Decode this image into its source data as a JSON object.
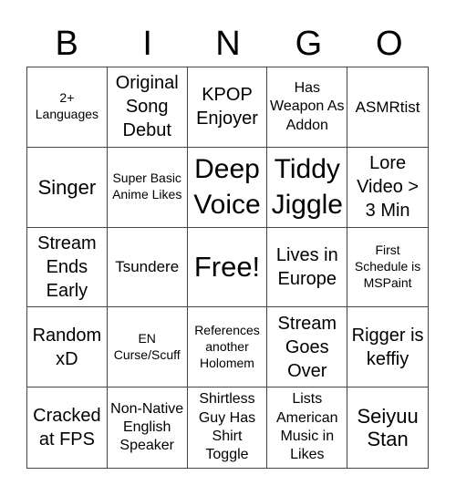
{
  "header": [
    "B",
    "I",
    "N",
    "G",
    "O"
  ],
  "cells": [
    {
      "text": "2+ Languages",
      "size": "s13"
    },
    {
      "text": "Original Song Debut",
      "size": "s20"
    },
    {
      "text": "KPOP Enjoyer",
      "size": "s20"
    },
    {
      "text": "Has Weapon As Addon",
      "size": "s15"
    },
    {
      "text": "ASMRtist",
      "size": "s17"
    },
    {
      "text": "Singer",
      "size": "s22"
    },
    {
      "text": "Super Basic Anime Likes",
      "size": "s13"
    },
    {
      "text": "Deep Voice",
      "size": "s28"
    },
    {
      "text": "Tiddy Jiggle",
      "size": "s28"
    },
    {
      "text": "Lore Video > 3 Min",
      "size": "s20"
    },
    {
      "text": "Stream Ends Early",
      "size": "s20"
    },
    {
      "text": "Tsundere",
      "size": "s17"
    },
    {
      "text": "Free!",
      "size": "s30"
    },
    {
      "text": "Lives in Europe",
      "size": "s20"
    },
    {
      "text": "First Schedule is MSPaint",
      "size": "s13"
    },
    {
      "text": "Random xD",
      "size": "s20"
    },
    {
      "text": "EN Curse/Scuff",
      "size": "s13"
    },
    {
      "text": "References another Holomem",
      "size": "s13"
    },
    {
      "text": "Stream Goes Over",
      "size": "s20"
    },
    {
      "text": "Rigger is keffiy",
      "size": "s20"
    },
    {
      "text": "Cracked at FPS",
      "size": "s20"
    },
    {
      "text": "Non-Native English Speaker",
      "size": "s15"
    },
    {
      "text": "Shirtless Guy Has Shirt Toggle",
      "size": "s15"
    },
    {
      "text": "Lists American Music in Likes",
      "size": "s15"
    },
    {
      "text": "Seiyuu Stan",
      "size": "s22"
    }
  ]
}
